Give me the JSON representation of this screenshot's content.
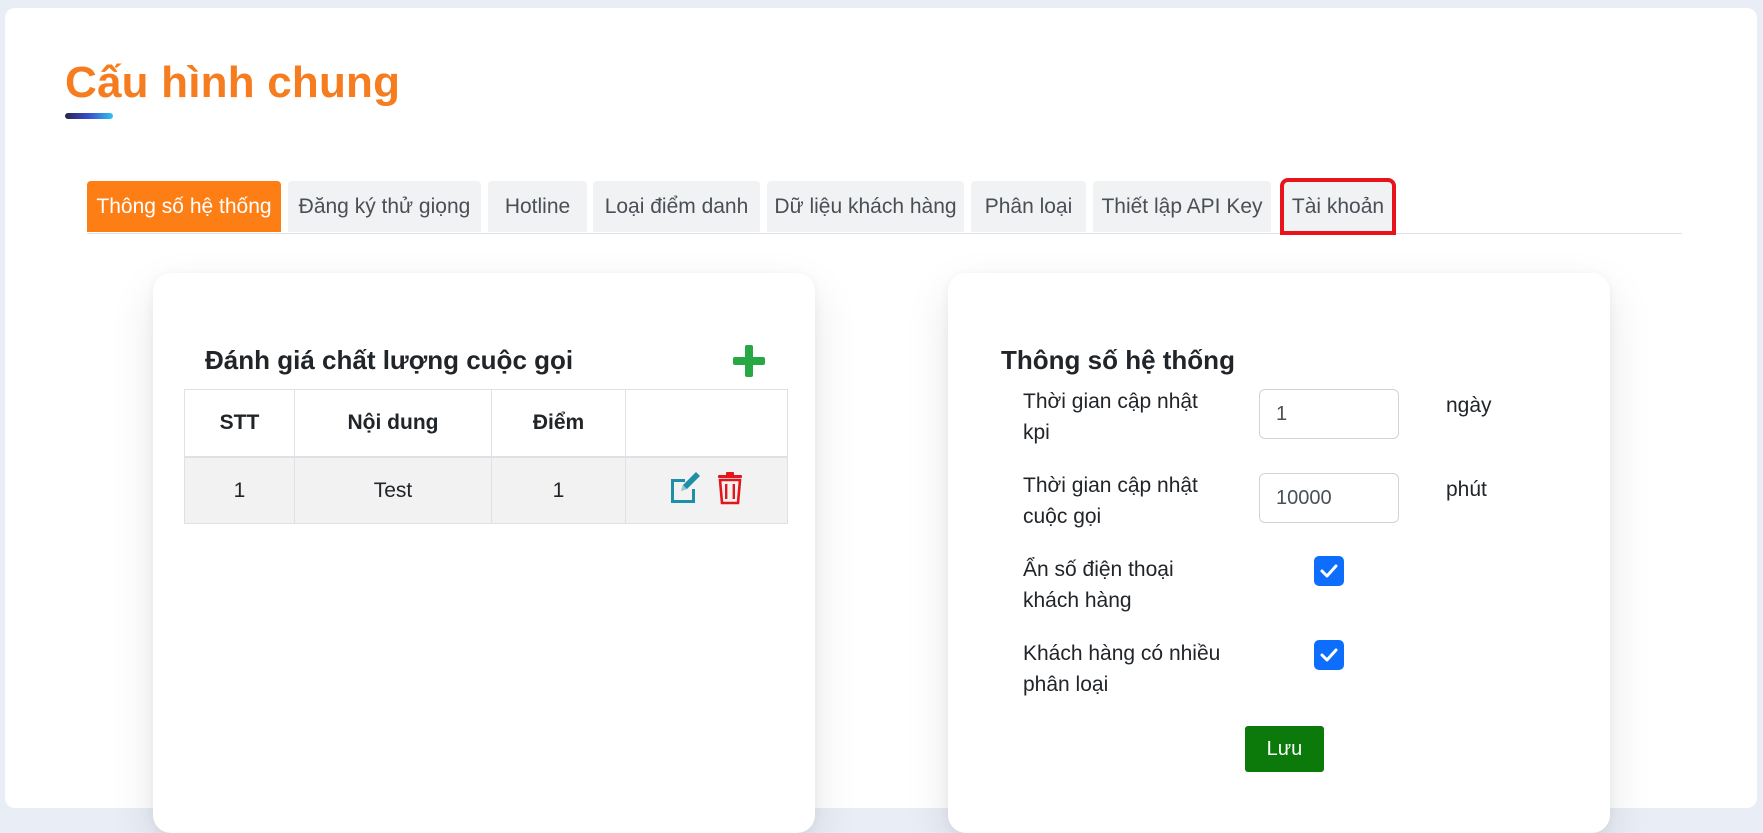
{
  "page": {
    "title": "Cấu hình chung"
  },
  "tabs": [
    {
      "label": "Thông số hệ thống",
      "active": true
    },
    {
      "label": "Đăng ký thử giọng",
      "active": false
    },
    {
      "label": "Hotline",
      "active": false
    },
    {
      "label": "Loại điểm danh",
      "active": false
    },
    {
      "label": "Dữ liệu khách hàng",
      "active": false
    },
    {
      "label": "Phân loại",
      "active": false
    },
    {
      "label": "Thiết lập API Key",
      "active": false
    },
    {
      "label": "Tài khoản",
      "active": false,
      "highlighted": true
    }
  ],
  "call_quality": {
    "title": "Đánh giá chất lượng cuộc gọi",
    "columns": [
      "STT",
      "Nội dung",
      "Điểm",
      ""
    ],
    "rows": [
      {
        "stt": "1",
        "content": "Test",
        "score": "1"
      }
    ]
  },
  "system_settings": {
    "title": "Thông số hệ thống",
    "kpi_update": {
      "label": "Thời gian cập nhật kpi",
      "value": "1",
      "unit": "ngày"
    },
    "call_update": {
      "label": "Thời gian cập nhật cuộc gọi",
      "value": "10000",
      "unit": "phút"
    },
    "hide_phone": {
      "label": "Ẩn số điện thoại khách hàng",
      "checked": true
    },
    "multi_category": {
      "label": "Khách hàng có nhiều phân loại",
      "checked": true
    },
    "save_label": "Lưu"
  },
  "colors": {
    "title": "#f57c1f",
    "active_tab": "#fd7e14",
    "highlight_outline": "#e8141b",
    "save_button": "#0b7a0b",
    "checkbox": "#0d6efd",
    "add_icon": "#28a745",
    "edit_icon": "#1f8fa8",
    "delete_icon": "#e3171b"
  }
}
